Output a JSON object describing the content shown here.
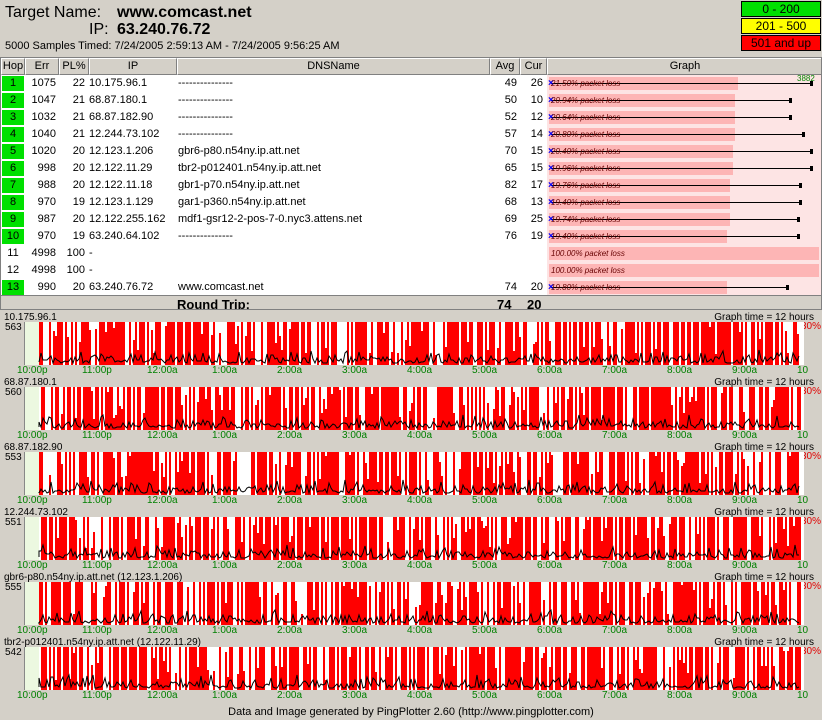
{
  "header": {
    "target_label": "Target Name:",
    "target_value": "www.comcast.net",
    "ip_label": "IP:",
    "ip_value": "63.240.76.72",
    "samples_text": "5000 Samples Timed:  7/24/2005 2:59:13 AM - 7/24/2005 9:56:25 AM"
  },
  "legend": [
    {
      "label": "0 - 200",
      "color": "#00e000"
    },
    {
      "label": "201 - 500",
      "color": "#ffff00"
    },
    {
      "label": "501 and up",
      "color": "#ff0000"
    }
  ],
  "columns": [
    "Hop",
    "Err",
    "PL%",
    "IP",
    "DNSName",
    "Avg",
    "Cur",
    "Graph"
  ],
  "graph_max": "3882",
  "hops": [
    {
      "hop": "1",
      "err": "1075",
      "pl": "22",
      "ip": "10.175.96.1",
      "dns": "---------------",
      "avg": "49",
      "cur": "26",
      "graph_label": "21.50% packet loss",
      "bar": 70,
      "whisker": 96,
      "ok": true
    },
    {
      "hop": "2",
      "err": "1047",
      "pl": "21",
      "ip": "68.87.180.1",
      "dns": "---------------",
      "avg": "50",
      "cur": "10",
      "graph_label": "20.94% packet loss",
      "bar": 69,
      "whisker": 88,
      "ok": true
    },
    {
      "hop": "3",
      "err": "1032",
      "pl": "21",
      "ip": "68.87.182.90",
      "dns": "---------------",
      "avg": "52",
      "cur": "12",
      "graph_label": "20.64% packet loss",
      "bar": 69,
      "whisker": 88,
      "ok": true
    },
    {
      "hop": "4",
      "err": "1040",
      "pl": "21",
      "ip": "12.244.73.102",
      "dns": "---------------",
      "avg": "57",
      "cur": "14",
      "graph_label": "20.80% packet loss",
      "bar": 69,
      "whisker": 93,
      "ok": true
    },
    {
      "hop": "5",
      "err": "1020",
      "pl": "20",
      "ip": "12.123.1.206",
      "dns": "gbr6-p80.n54ny.ip.att.net",
      "avg": "70",
      "cur": "15",
      "graph_label": "20.40% packet loss",
      "bar": 68,
      "whisker": 96,
      "ok": true
    },
    {
      "hop": "6",
      "err": "998",
      "pl": "20",
      "ip": "12.122.11.29",
      "dns": "tbr2-p012401.n54ny.ip.att.net",
      "avg": "65",
      "cur": "15",
      "graph_label": "19.96% packet loss",
      "bar": 68,
      "whisker": 96,
      "ok": true
    },
    {
      "hop": "7",
      "err": "988",
      "pl": "20",
      "ip": "12.122.11.18",
      "dns": "gbr1-p70.n54ny.ip.att.net",
      "avg": "82",
      "cur": "17",
      "graph_label": "19.76% packet loss",
      "bar": 67,
      "whisker": 92,
      "ok": true
    },
    {
      "hop": "8",
      "err": "970",
      "pl": "19",
      "ip": "12.123.1.129",
      "dns": "gar1-p360.n54ny.ip.att.net",
      "avg": "68",
      "cur": "13",
      "graph_label": "19.40% packet loss",
      "bar": 67,
      "whisker": 92,
      "ok": true
    },
    {
      "hop": "9",
      "err": "987",
      "pl": "20",
      "ip": "12.122.255.162",
      "dns": "mdf1-gsr12-2-pos-7-0.nyc3.attens.net",
      "avg": "69",
      "cur": "25",
      "graph_label": "19.74% packet loss",
      "bar": 67,
      "whisker": 91,
      "ok": true
    },
    {
      "hop": "10",
      "err": "970",
      "pl": "19",
      "ip": "63.240.64.102",
      "dns": "---------------",
      "avg": "76",
      "cur": "19",
      "graph_label": "19.40% packet loss",
      "bar": 66,
      "whisker": 91,
      "ok": true
    },
    {
      "hop": "11",
      "err": "4998",
      "pl": "100",
      "ip": "-",
      "dns": "",
      "avg": "",
      "cur": "",
      "graph_label": "100.00% packet loss",
      "bar": 100,
      "whisker": 0,
      "ok": false
    },
    {
      "hop": "12",
      "err": "4998",
      "pl": "100",
      "ip": "-",
      "dns": "",
      "avg": "",
      "cur": "",
      "graph_label": "100.00% packet loss",
      "bar": 100,
      "whisker": 0,
      "ok": false
    },
    {
      "hop": "13",
      "err": "990",
      "pl": "20",
      "ip": "63.240.76.72",
      "dns": "www.comcast.net",
      "avg": "74",
      "cur": "20",
      "graph_label": "19.80% packet loss",
      "bar": 66,
      "whisker": 87,
      "ok": true
    }
  ],
  "round_trip": {
    "label": "Round Trip:",
    "avg": "74",
    "cur": "20"
  },
  "graph_time": "Graph time = 12 hours",
  "pl_max": "30%",
  "x_ticks": [
    "10:00p",
    "11:00p",
    "12:00a",
    "1:00a",
    "2:00a",
    "3:00a",
    "4:00a",
    "5:00a",
    "6:00a",
    "7:00a",
    "8:00a",
    "9:00a",
    "10"
  ],
  "charts": [
    {
      "title": "10.175.96.1",
      "ymax": "563"
    },
    {
      "title": "68.87.180.1",
      "ymax": "560"
    },
    {
      "title": "68.87.182.90",
      "ymax": "553"
    },
    {
      "title": "12.244.73.102",
      "ymax": "551"
    },
    {
      "title": "gbr6-p80.n54ny.ip.att.net (12.123.1.206)",
      "ymax": "555"
    },
    {
      "title": "tbr2-p012401.n54ny.ip.att.net (12.122.11.29)",
      "ymax": "542"
    }
  ],
  "footer": "Data and Image generated by PingPlotter 2.60 (http://www.pingplotter.com)"
}
